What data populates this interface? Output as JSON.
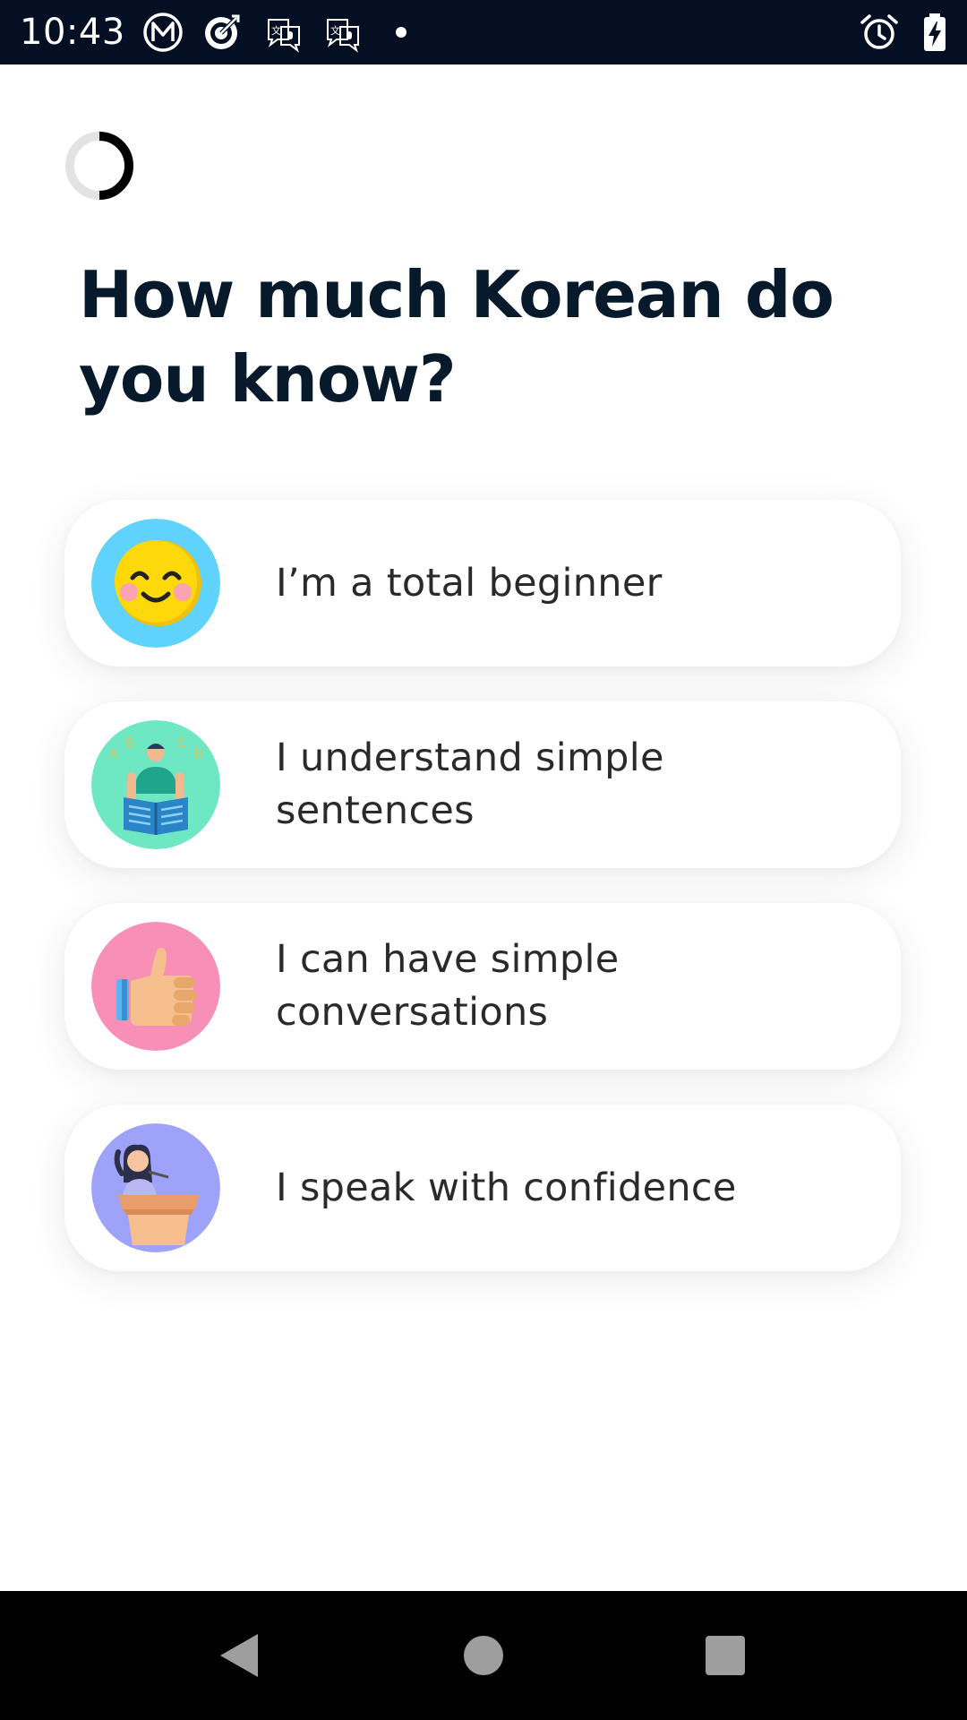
{
  "status_bar": {
    "time": "10:43",
    "icons": [
      "motorola-m-icon",
      "target-icon",
      "translate-mic-icon",
      "translate-mic-icon",
      "notification-dot-icon",
      "alarm-icon",
      "battery-charging-icon"
    ]
  },
  "progress": {
    "fraction": 0.5
  },
  "question": {
    "title": "How much Korean do you know?"
  },
  "options": [
    {
      "label": "I’m a total beginner",
      "icon": "smiling-face-icon",
      "color": "#5fd3fb"
    },
    {
      "label": "I understand simple sentences",
      "icon": "reading-person-icon",
      "color": "#6ee8c3"
    },
    {
      "label": "I can have simple conversations",
      "icon": "thumbs-up-icon",
      "color": "#f78fb6"
    },
    {
      "label": "I speak with confidence",
      "icon": "speaker-at-podium-icon",
      "color": "#9ea3f9"
    }
  ],
  "nav_bar": {
    "buttons": [
      "back-icon",
      "home-icon",
      "recents-icon"
    ]
  },
  "colors": {
    "status_bar_bg": "#040f24",
    "title_text": "#061a2c",
    "option_text": "#2a2a2a",
    "nav_bar_bg": "#000000"
  }
}
